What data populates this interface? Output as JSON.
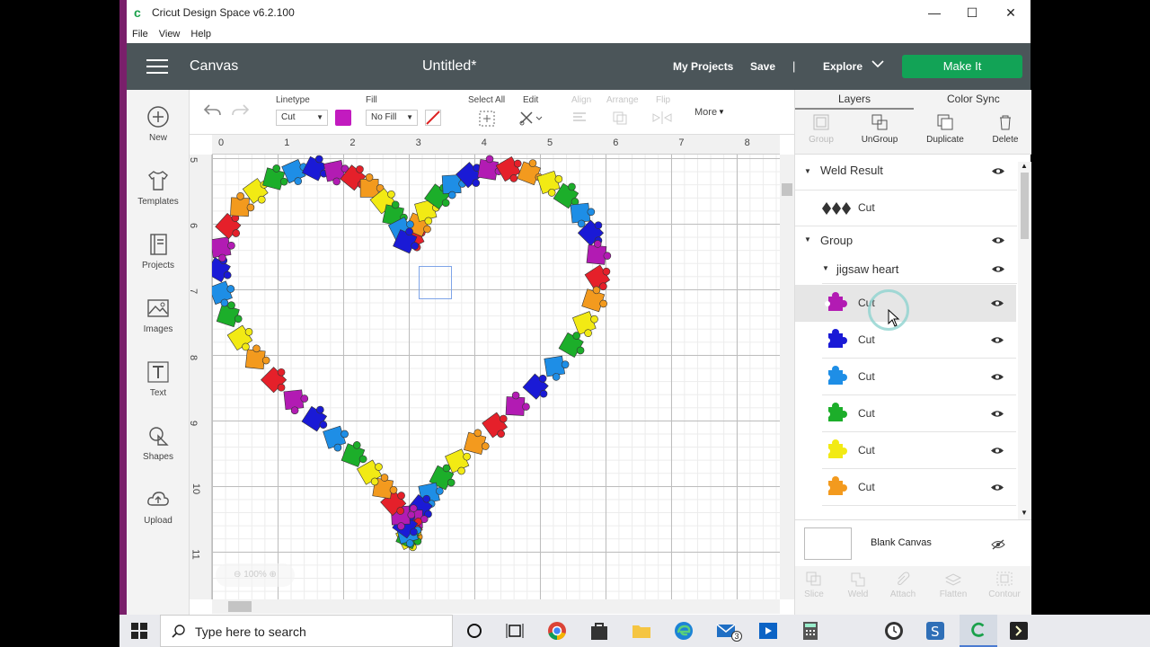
{
  "window": {
    "title": "Cricut Design Space  v6.2.100",
    "minimize": "—",
    "maximize": "☐",
    "close": "✕"
  },
  "menu": [
    "File",
    "View",
    "Help"
  ],
  "header": {
    "section": "Canvas",
    "doc_title": "Untitled*",
    "my_projects": "My Projects",
    "save": "Save",
    "separator": "|",
    "explore": "Explore",
    "make_it": "Make It"
  },
  "sidebar": [
    {
      "label": "New",
      "icon": "plus-circle-icon"
    },
    {
      "label": "Templates",
      "icon": "tshirt-icon"
    },
    {
      "label": "Projects",
      "icon": "book-icon"
    },
    {
      "label": "Images",
      "icon": "image-icon"
    },
    {
      "label": "Text",
      "icon": "text-t-icon"
    },
    {
      "label": "Shapes",
      "icon": "shapes-icon"
    },
    {
      "label": "Upload",
      "icon": "cloud-upload-icon"
    }
  ],
  "toolbar": {
    "linetype_label": "Linetype",
    "linetype_value": "Cut",
    "fill_label": "Fill",
    "fill_value": "No Fill",
    "linetype_color": "#c21bbf",
    "select_all": "Select All",
    "edit": "Edit",
    "align": "Align",
    "arrange": "Arrange",
    "flip": "Flip",
    "more": "More"
  },
  "rulers": {
    "top": [
      "0",
      "1",
      "2",
      "3",
      "4",
      "5",
      "6",
      "7",
      "8"
    ],
    "left": [
      "5",
      "6",
      "7",
      "8",
      "9",
      "10",
      "11"
    ]
  },
  "zoom": "100%",
  "panel": {
    "tabs": [
      "Layers",
      "Color Sync"
    ],
    "actions": [
      {
        "label": "Group",
        "enabled": false
      },
      {
        "label": "UnGroup",
        "enabled": true
      },
      {
        "label": "Duplicate",
        "enabled": true
      },
      {
        "label": "Delete",
        "enabled": true
      }
    ],
    "weld_result": "Weld Result",
    "weld_cut": "Cut",
    "group": "Group",
    "jigsaw": "jigsaw heart",
    "layers": [
      {
        "label": "Cut",
        "color": "#b21bb3"
      },
      {
        "label": "Cut",
        "color": "#1a1ad6"
      },
      {
        "label": "Cut",
        "color": "#1e8ee6"
      },
      {
        "label": "Cut",
        "color": "#1cae2a"
      },
      {
        "label": "Cut",
        "color": "#f2ea14"
      },
      {
        "label": "Cut",
        "color": "#f39a1e"
      }
    ],
    "blank_canvas": "Blank Canvas",
    "bottom_actions": [
      "Slice",
      "Weld",
      "Attach",
      "Flatten",
      "Contour"
    ]
  },
  "taskbar": {
    "search_placeholder": "Type here to search",
    "mail_badge": "3"
  },
  "heart_colors": [
    "#e5202a",
    "#f39a1e",
    "#f2ea14",
    "#1cae2a",
    "#1e8ee6",
    "#1a1ad6",
    "#b21bb3"
  ]
}
